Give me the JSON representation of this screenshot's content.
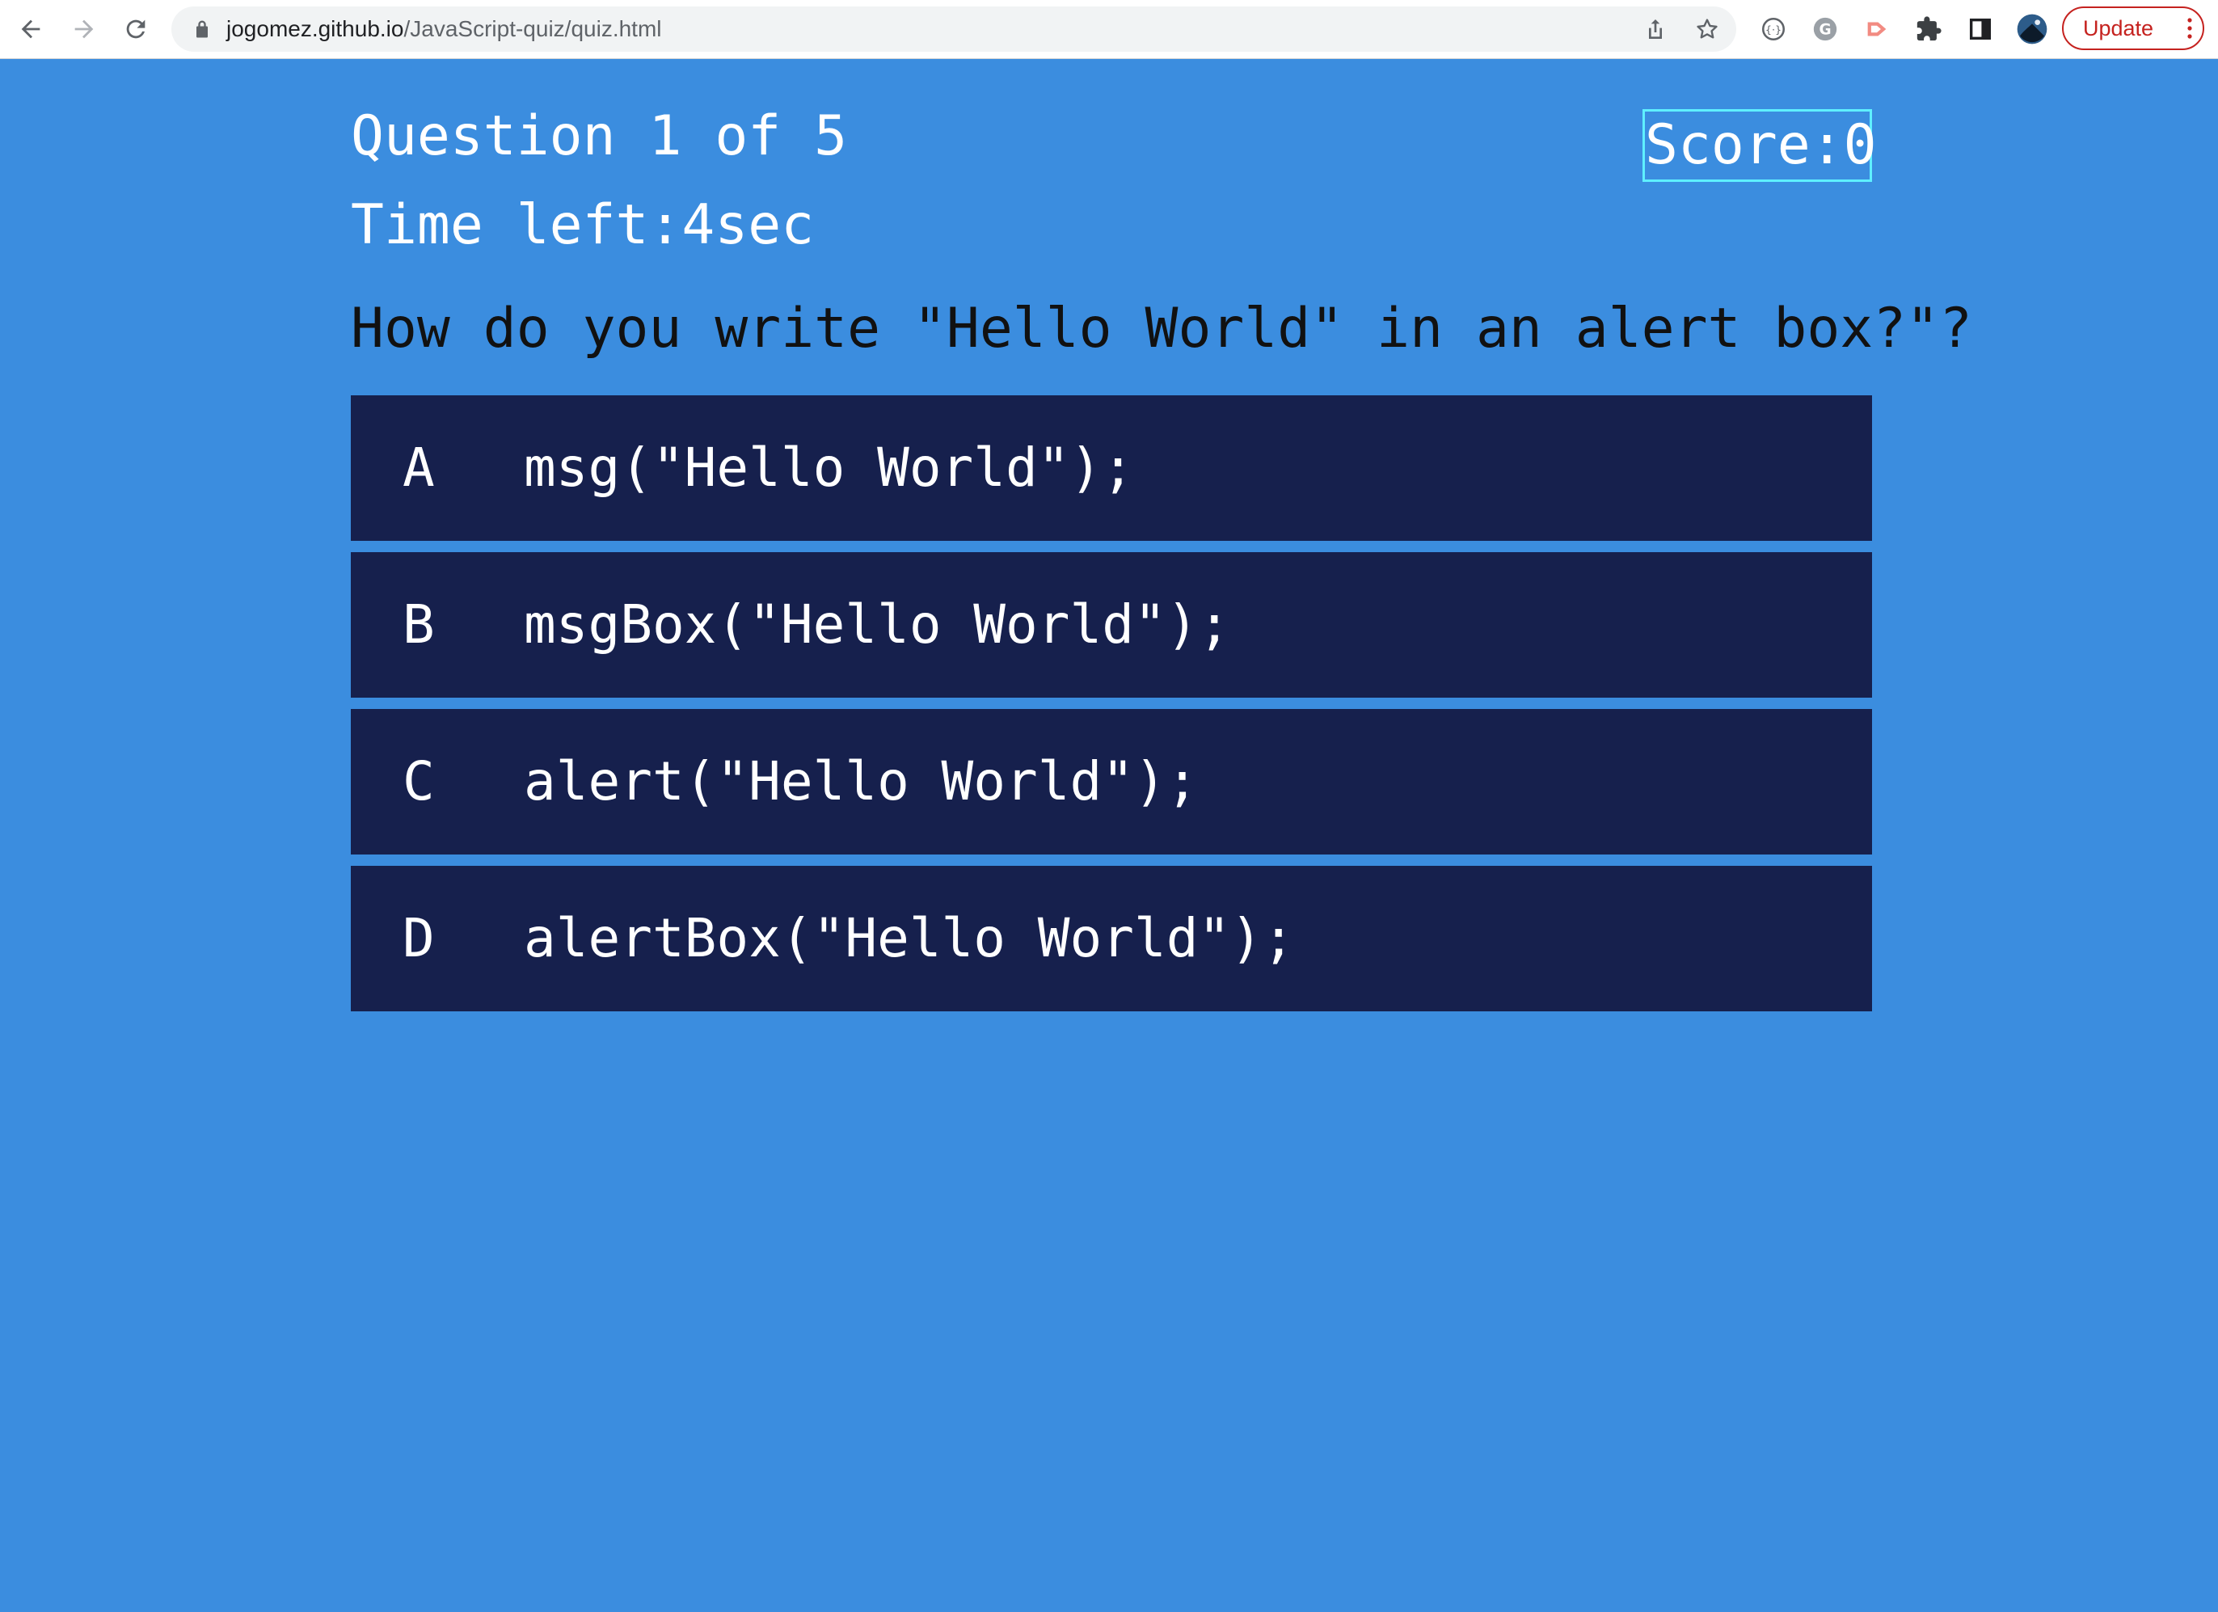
{
  "browser": {
    "url_domain": "jogomez.github.io",
    "url_path": "/JavaScript-quiz/quiz.html",
    "update_label": "Update"
  },
  "quiz": {
    "question_counter": "Question 1 of 5",
    "score": "Score:0",
    "time_left": "Time left:4sec",
    "question": "How do you write \"Hello World\" in an alert box?\"?",
    "answers": [
      {
        "letter": "A",
        "text": "msg(\"Hello World\");"
      },
      {
        "letter": "B",
        "text": "msgBox(\"Hello World\");"
      },
      {
        "letter": "C",
        "text": "alert(\"Hello World\");"
      },
      {
        "letter": "D",
        "text": "alertBox(\"Hello World\");"
      }
    ]
  },
  "colors": {
    "page_background": "#3b8ddf",
    "answer_background": "#16204d",
    "score_border": "#5ff0ff",
    "update_accent": "#c5221f"
  }
}
